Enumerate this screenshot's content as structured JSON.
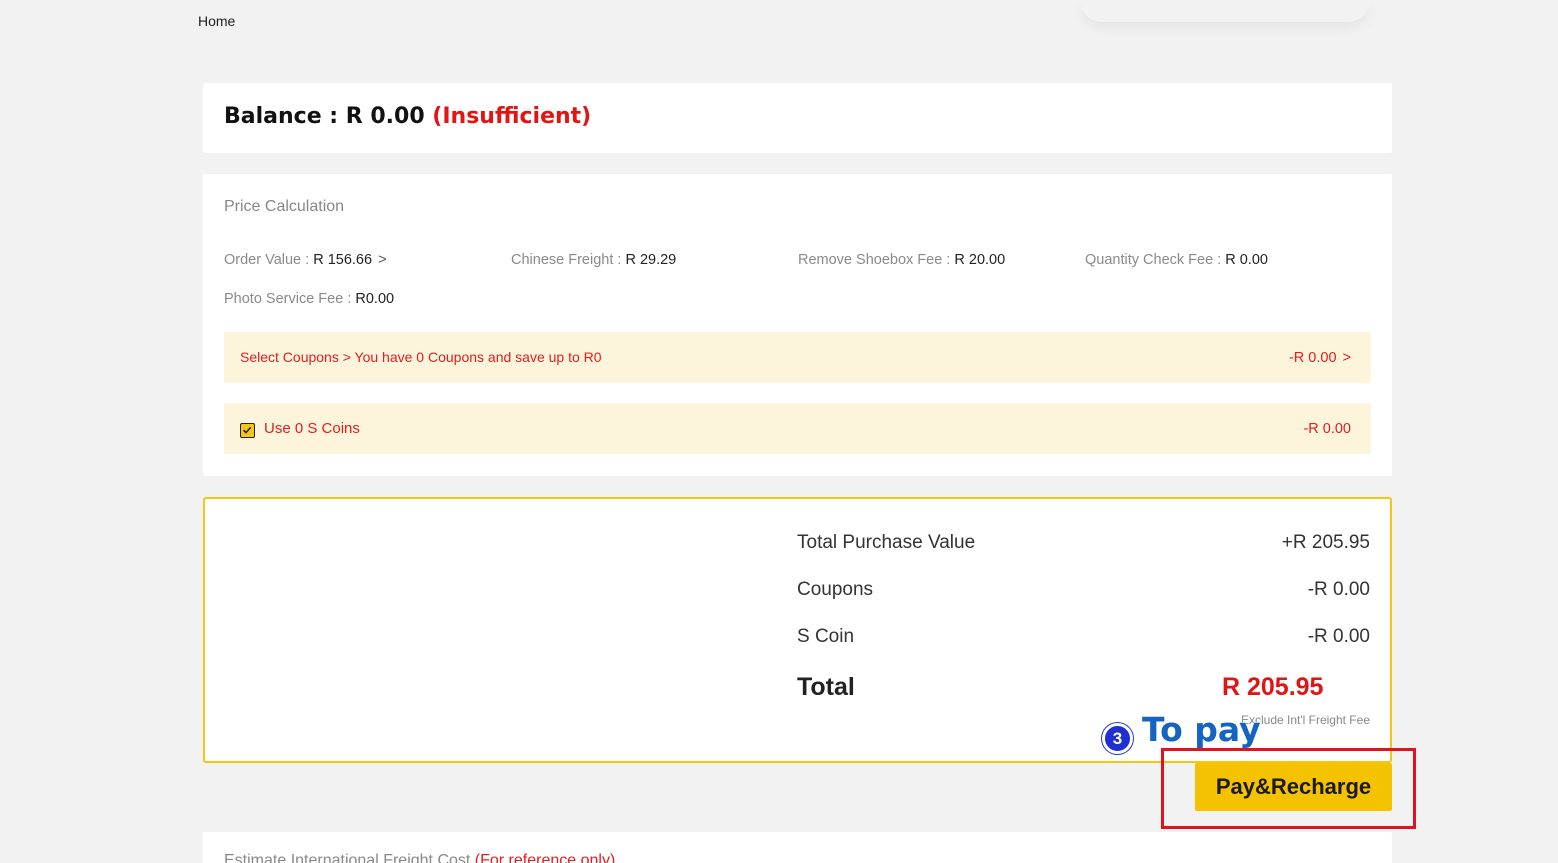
{
  "nav": {
    "home_label": "Home"
  },
  "balance": {
    "label": "Balance : R 0.00",
    "status": "(Insufficient)"
  },
  "price_calculation": {
    "title": "Price Calculation",
    "order_value": {
      "label": "Order Value : ",
      "value": "R 156.66",
      "chevron": ">"
    },
    "chinese_freight": {
      "label": "Chinese Freight : ",
      "value": "R 29.29"
    },
    "remove_shoebox_fee": {
      "label": "Remove Shoebox Fee : ",
      "value": "R 20.00"
    },
    "quantity_check_fee": {
      "label": "Quantity Check Fee : ",
      "value": "R 0.00"
    },
    "photo_service_fee": {
      "label": "Photo Service Fee : ",
      "value": "R0.00"
    },
    "coupons_band": {
      "text": "Select Coupons > You have 0 Coupons and save up to R0",
      "amount": "-R 0.00",
      "chevron": ">"
    },
    "coins_band": {
      "checked": true,
      "label": "Use 0 S Coins",
      "amount": "-R 0.00"
    }
  },
  "summary": {
    "rows": [
      {
        "label": "Total Purchase Value",
        "value": "+R 205.95"
      },
      {
        "label": "Coupons",
        "value": "-R 0.00"
      },
      {
        "label": "S Coin",
        "value": "-R 0.00"
      }
    ],
    "total_label": "Total",
    "total_value": "R 205.95",
    "note": "Exclude Int'l Freight Fee"
  },
  "annotation": {
    "step_number": "3",
    "step_text": "To pay",
    "badge_color": "#1f2fd0",
    "text_color": "#1565c0",
    "box_color": "#e0141c"
  },
  "pay_button": {
    "label": "Pay&Recharge",
    "color": "#f5c200"
  },
  "freight_estimate": {
    "title": "Estimate International Freight Cost ",
    "note": "(For reference only)"
  },
  "colors": {
    "accent_yellow": "#f5c518",
    "alert_red": "#e01515",
    "band_bg": "#fdf4dc",
    "page_bg": "#f2f2f2"
  }
}
